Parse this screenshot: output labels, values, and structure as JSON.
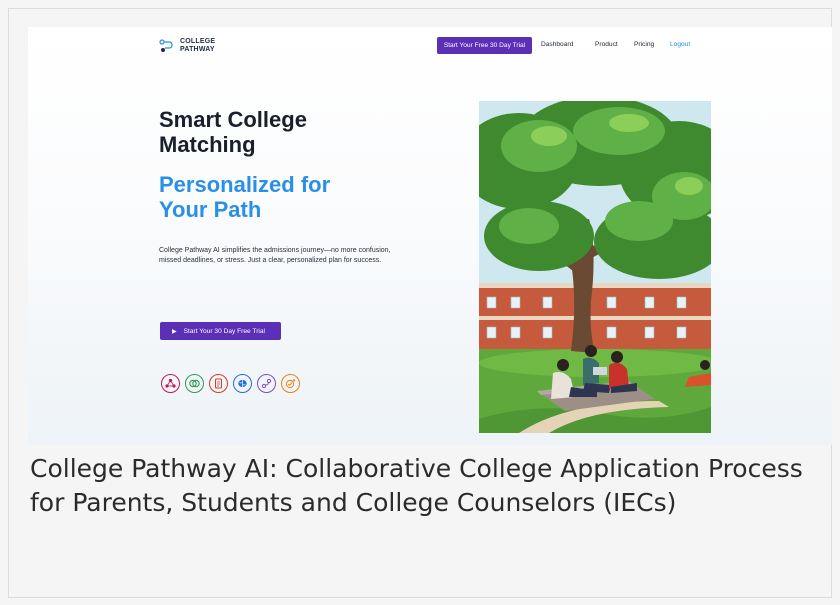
{
  "nav": {
    "logo_text": "COLLEGE\nPATHWAY",
    "cta_label": "Start Your Free 30 Day Trial",
    "links": [
      {
        "label": "Dashboard"
      },
      {
        "label": "Product"
      },
      {
        "label": "Pricing"
      },
      {
        "label": "Logout"
      }
    ],
    "colors": {
      "cta": "#5b2fb6",
      "logout": "#2a8ee6"
    }
  },
  "hero": {
    "title_line1": "Smart College",
    "title_line2": "Matching",
    "subtitle_line1": "Personalized for",
    "subtitle_line2": "Your Path",
    "description": "College Pathway AI simplifies the admissions journey—no more confusion, missed deadlines, or stress. Just a clear, personalized plan for success.",
    "cta_label": "Start Your 30 Day Free Trial",
    "colors": {
      "title": "#1a1f2b",
      "accent": "#2b8fe8",
      "button": "#5b2fb6"
    }
  },
  "features": [
    {
      "icon": "network-icon",
      "color": "#c2185b"
    },
    {
      "icon": "venn-icon",
      "color": "#2e9d4f"
    },
    {
      "icon": "document-icon",
      "color": "#d63a2b"
    },
    {
      "icon": "brain-icon",
      "color": "#1e6fd9"
    },
    {
      "icon": "pathway-icon",
      "color": "#7a4fc9"
    },
    {
      "icon": "check-badge-icon",
      "color": "#e6830f"
    }
  ],
  "illustration": {
    "alt": "students studying under a tree on a campus lawn"
  },
  "caption": "College Pathway AI: Collaborative College Application Process for Parents, Students and College Counselors (IECs)"
}
